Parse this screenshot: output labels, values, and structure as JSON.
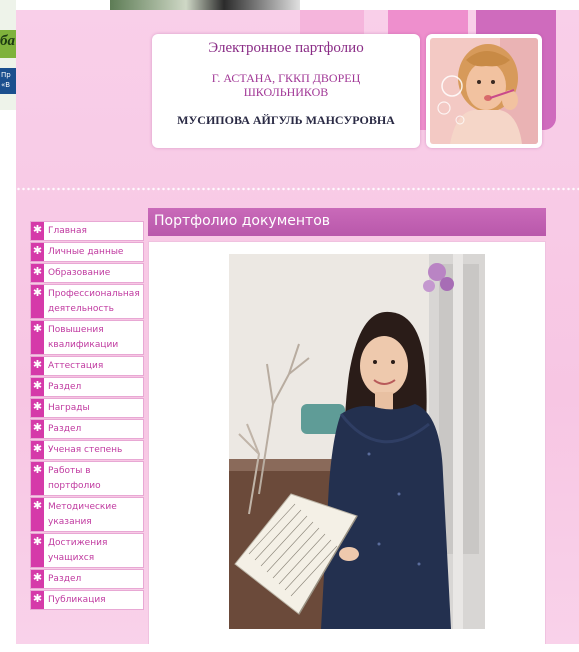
{
  "fragment": {
    "green_text": "ба",
    "blue_text_1": "Пр",
    "blue_text_2": "«В"
  },
  "header": {
    "title": "Электронное партфолио",
    "city": "Г. АСТАНА,  ГККП ДВОРЕЦ ШКОЛЬНИКОВ",
    "name": "МУСИПОВА АЙГУЛЬ МАНСУРОВНА"
  },
  "menu": {
    "items": [
      {
        "label": "Главная"
      },
      {
        "label": "Личные данные"
      },
      {
        "label": "Образование"
      },
      {
        "label": "Профессиональная деятельность"
      },
      {
        "label": "Повышения квалификации"
      },
      {
        "label": "Аттестация"
      },
      {
        "label": "Раздел"
      },
      {
        "label": "Награды"
      },
      {
        "label": "Раздел"
      },
      {
        "label": "Ученая степень"
      },
      {
        "label": "Работы в портфолио"
      },
      {
        "label": "Методические указания"
      },
      {
        "label": "Достижения учащихся"
      },
      {
        "label": "Раздел"
      },
      {
        "label": "Публикация"
      }
    ],
    "bullet": "✱"
  },
  "content": {
    "title": "Портфолио документов"
  },
  "colors": {
    "accent": "#d53aa9",
    "header_bar": "#c96ab9",
    "background": "#f7c6e3"
  }
}
